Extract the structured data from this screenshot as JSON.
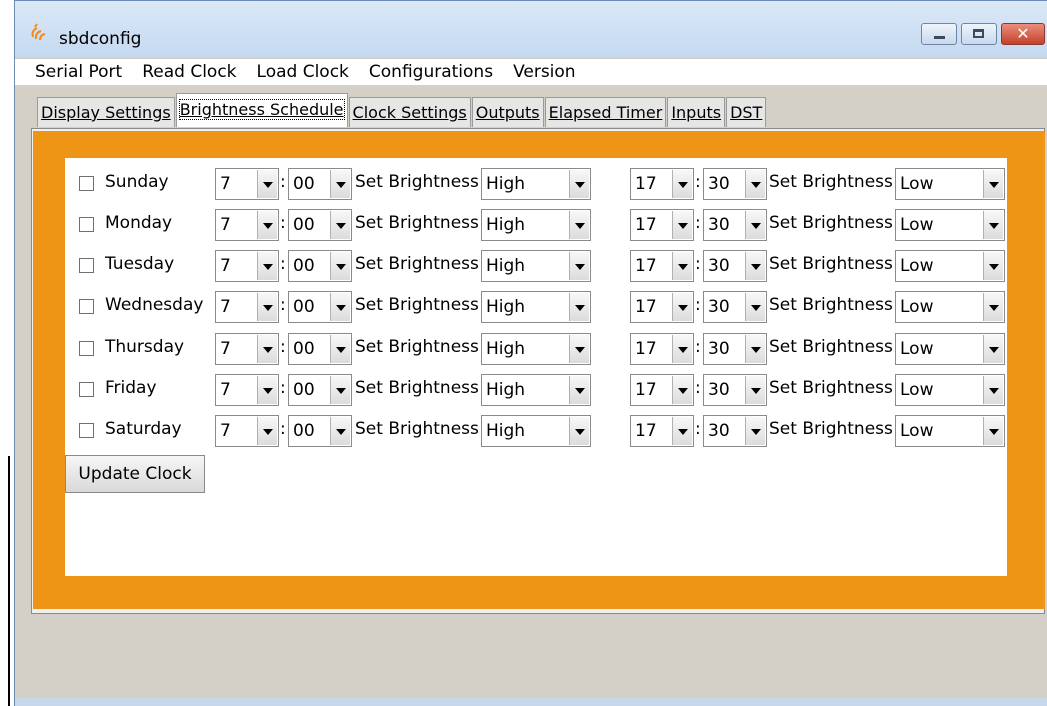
{
  "window": {
    "title": "sbdconfig",
    "close_glyph": "✕"
  },
  "menu": [
    "Serial Port",
    "Read Clock",
    "Load Clock",
    "Configurations",
    "Version"
  ],
  "tabs": [
    "Display Settings",
    "Brightness Schedule",
    "Clock Settings",
    "Outputs",
    "Elapsed Timer",
    "Inputs",
    "DST"
  ],
  "active_tab": "Brightness Schedule",
  "schedule": {
    "set_label": "Set Brightness",
    "colon": ":",
    "rows": [
      {
        "day": "Sunday",
        "checked": false,
        "on_hour": "7",
        "on_min": "00",
        "on_level": "High",
        "off_hour": "17",
        "off_min": "30",
        "off_level": "Low"
      },
      {
        "day": "Monday",
        "checked": false,
        "on_hour": "7",
        "on_min": "00",
        "on_level": "High",
        "off_hour": "17",
        "off_min": "30",
        "off_level": "Low"
      },
      {
        "day": "Tuesday",
        "checked": false,
        "on_hour": "7",
        "on_min": "00",
        "on_level": "High",
        "off_hour": "17",
        "off_min": "30",
        "off_level": "Low"
      },
      {
        "day": "Wednesday",
        "checked": false,
        "on_hour": "7",
        "on_min": "00",
        "on_level": "High",
        "off_hour": "17",
        "off_min": "30",
        "off_level": "Low"
      },
      {
        "day": "Thursday",
        "checked": false,
        "on_hour": "7",
        "on_min": "00",
        "on_level": "High",
        "off_hour": "17",
        "off_min": "30",
        "off_level": "Low"
      },
      {
        "day": "Friday",
        "checked": false,
        "on_hour": "7",
        "on_min": "00",
        "on_level": "High",
        "off_hour": "17",
        "off_min": "30",
        "off_level": "Low"
      },
      {
        "day": "Saturday",
        "checked": false,
        "on_hour": "7",
        "on_min": "00",
        "on_level": "High",
        "off_hour": "17",
        "off_min": "30",
        "off_level": "Low"
      }
    ]
  },
  "update_button": "Update Clock",
  "colors": {
    "panel_accent": "#ef9516",
    "title_gradient_top": "#dbe8f7",
    "close_button": "#c5402a"
  },
  "icons": {
    "app": "sbd-app-icon",
    "minimize": "minimize-icon",
    "maximize": "maximize-icon",
    "close": "close-icon",
    "dropdown": "chevron-down-icon"
  }
}
